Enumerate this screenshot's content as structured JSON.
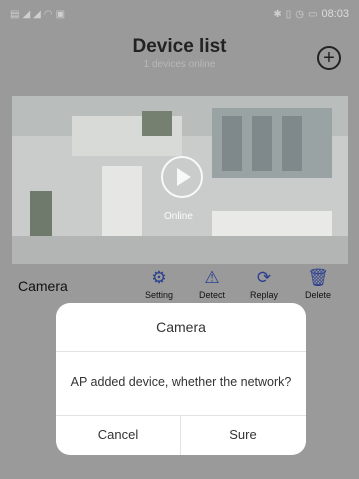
{
  "status_bar": {
    "time": "08:03",
    "left_icons": [
      "sim-icon",
      "signal-icon",
      "signal-icon",
      "wifi-icon",
      "notification-icon"
    ],
    "right_icons": [
      "bluetooth-icon",
      "vibrate-icon",
      "alarm-icon",
      "battery-icon"
    ]
  },
  "header": {
    "title": "Device list",
    "subtitle": "1 devices online",
    "add_icon": "plus-circle-icon"
  },
  "camera": {
    "status": "Online",
    "name": "Camera",
    "actions": [
      {
        "label": "Setting",
        "icon": "gear-icon"
      },
      {
        "label": "Detect",
        "icon": "warning-triangle-icon"
      },
      {
        "label": "Replay",
        "icon": "replay-icon"
      },
      {
        "label": "Delete",
        "icon": "trash-icon"
      }
    ]
  },
  "dialog": {
    "title": "Camera",
    "message": "AP added device, whether the network?",
    "cancel": "Cancel",
    "confirm": "Sure"
  },
  "colors": {
    "accent": "#2b3f8f",
    "overlay": "#9a9a9a"
  }
}
